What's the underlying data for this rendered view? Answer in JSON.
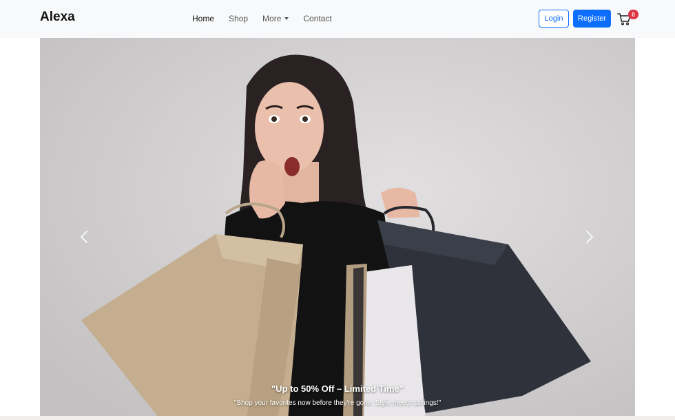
{
  "navbar": {
    "brand": "Alexa",
    "links": [
      {
        "label": "Home",
        "active": true
      },
      {
        "label": "Shop",
        "active": false
      },
      {
        "label": "More",
        "active": false,
        "dropdown": true
      },
      {
        "label": "Contact",
        "active": false
      }
    ],
    "login_label": "Login",
    "register_label": "Register",
    "cart_icon": "cart-icon",
    "cart_count": "0"
  },
  "carousel": {
    "slide": {
      "title": "\"Up to 50% Off – Limited Time\"",
      "text": "\"Shop your favorites now before they're gone. Style meets savings!\""
    },
    "prev_icon": "chevron-left-icon",
    "next_icon": "chevron-right-icon"
  },
  "colors": {
    "navbar_bg": "#f8f9fa",
    "primary": "#0d6efd",
    "badge": "#dc3545"
  }
}
